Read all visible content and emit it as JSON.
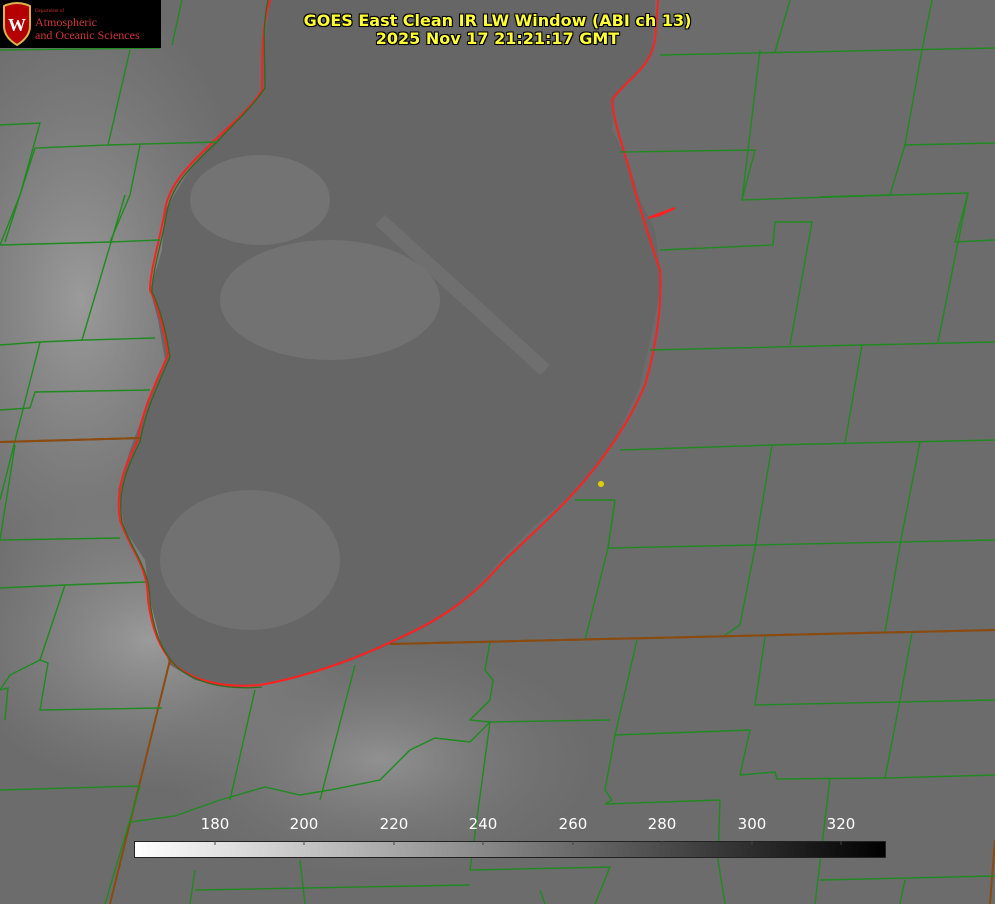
{
  "header": {
    "title_line1": "GOES East Clean IR LW Window (ABI ch 13)",
    "title_line2": "2025 Nov 17 21:21:17 GMT"
  },
  "logo": {
    "department": "Department of",
    "line1": "Atmospheric",
    "line2": "and Oceanic Sciences",
    "crest_letter": "W"
  },
  "colorbar": {
    "ticks": [
      "180",
      "200",
      "220",
      "240",
      "260",
      "280",
      "300",
      "320"
    ],
    "gradient": [
      "#ffffff",
      "#000000"
    ]
  },
  "colors": {
    "county_lines": "#1f8a1f",
    "state_lines": "#8a4a10",
    "lake_outline": "#ff2020",
    "marker": "#e0d000",
    "title_text": "#ffff33"
  }
}
